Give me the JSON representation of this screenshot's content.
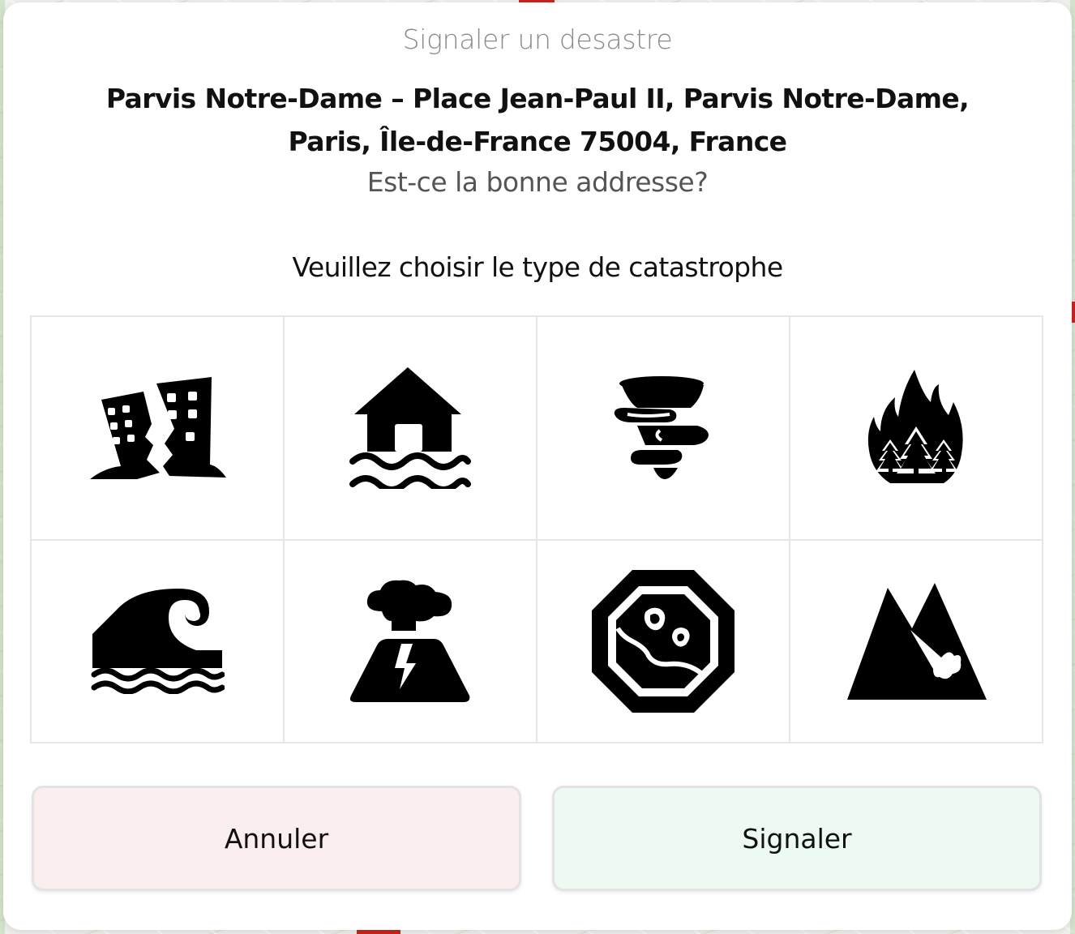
{
  "modal": {
    "title": "Signaler un desastre",
    "address": "Parvis Notre-Dame – Place Jean-Paul II, Parvis Notre-Dame, Paris, Île-de-France 75004, France",
    "confirm_question": "Est-ce la bonne addresse?",
    "choose_title": "Veuillez choisir le type de catastrophe"
  },
  "disaster_types": [
    {
      "icon": "earthquake-icon"
    },
    {
      "icon": "flood-icon"
    },
    {
      "icon": "tornado-icon"
    },
    {
      "icon": "wildfire-icon"
    },
    {
      "icon": "tsunami-icon"
    },
    {
      "icon": "volcano-icon"
    },
    {
      "icon": "ground-collapse-icon"
    },
    {
      "icon": "landslide-icon"
    }
  ],
  "buttons": {
    "cancel_label": "Annuler",
    "report_label": "Signaler"
  },
  "colors": {
    "cancel_bg": "#faeeee",
    "report_bg": "#ecfaf2",
    "title_gray": "#8a8a8a"
  }
}
